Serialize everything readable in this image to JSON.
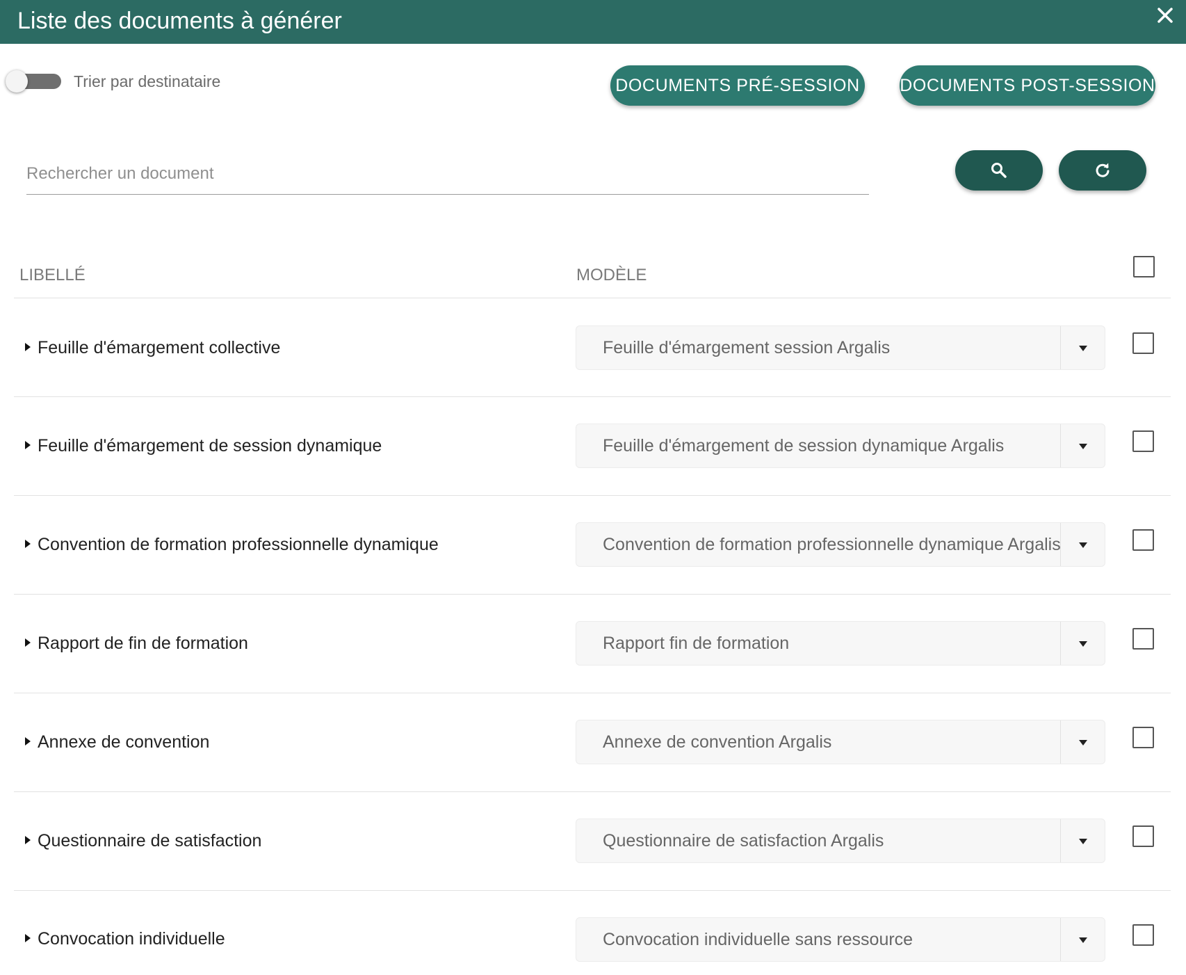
{
  "dialog": {
    "title": "Liste des documents à générer",
    "close_icon": "close-icon",
    "accent_color": "#2c6b63"
  },
  "toolbar": {
    "sort_toggle_label": "Trier par destinataire",
    "sort_toggle_on": false,
    "pre_session_label": "DOCUMENTS PRÉ-SESSION",
    "post_session_label": "DOCUMENTS POST-SESSION"
  },
  "search": {
    "placeholder": "Rechercher un document",
    "value": "",
    "search_icon": "search-icon",
    "refresh_icon": "refresh-icon"
  },
  "table": {
    "col_label": "LIBELLÉ",
    "col_model": "MODÈLE",
    "select_all_checked": false,
    "rows": [
      {
        "label": "Feuille d'émargement collective",
        "model": "Feuille d'émargement session Argalis",
        "checked": false
      },
      {
        "label": "Feuille d'émargement de session dynamique",
        "model": "Feuille d'émargement de session dynamique Argalis",
        "checked": false
      },
      {
        "label": "Convention de formation professionnelle dynamique",
        "model": "Convention de formation professionnelle dynamique Argalis",
        "checked": false
      },
      {
        "label": "Rapport de fin de formation",
        "model": "Rapport fin de formation",
        "checked": false
      },
      {
        "label": "Annexe de convention",
        "model": "Annexe de convention Argalis",
        "checked": false
      },
      {
        "label": "Questionnaire de satisfaction",
        "model": "Questionnaire de satisfaction Argalis",
        "checked": false
      },
      {
        "label": "Convocation individuelle",
        "model": "Convocation individuelle sans ressource",
        "checked": false
      }
    ]
  }
}
